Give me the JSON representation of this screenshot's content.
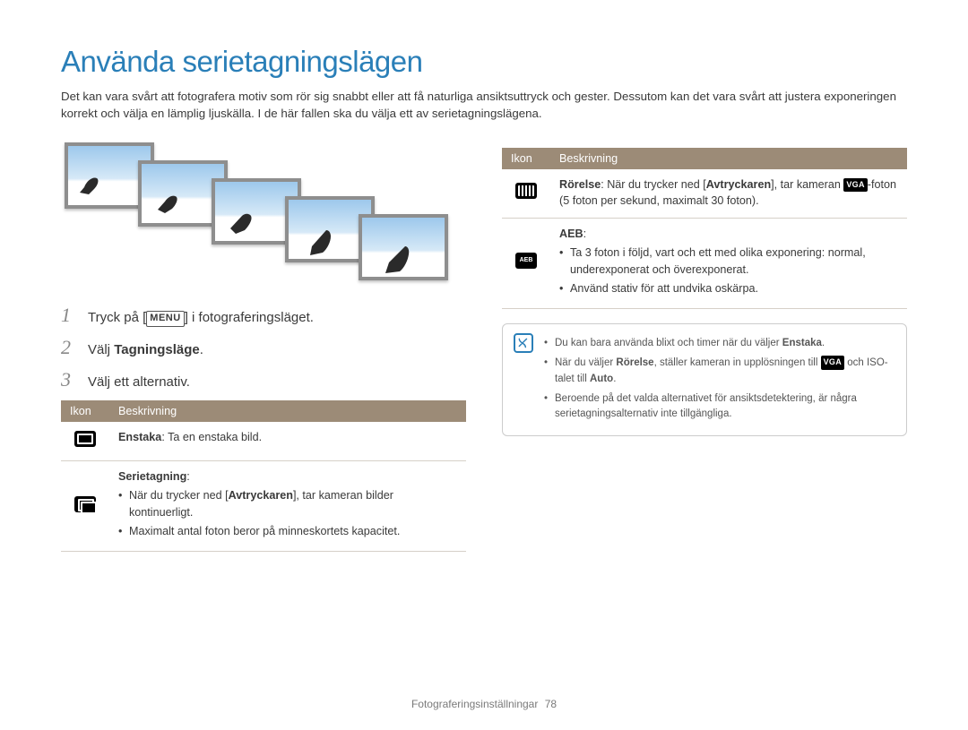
{
  "title": "Använda serietagningslägen",
  "intro": "Det kan vara svårt att fotografera motiv som rör sig snabbt eller att få naturliga ansiktsuttryck och gester. Dessutom kan det vara svårt att justera exponeringen korrekt och välja en lämplig ljuskälla. I de här fallen ska du välja ett av serietagningslägena.",
  "steps": {
    "s1_a": "Tryck på [",
    "s1_menu": "MENU",
    "s1_b": "] i fotograferingsläget.",
    "s2_a": "Välj ",
    "s2_b": "Tagningsläge",
    "s2_c": ".",
    "s3": "Välj ett alternativ."
  },
  "table_headers": {
    "icon": "Ikon",
    "desc": "Beskrivning"
  },
  "left_rows": {
    "single_label": "Enstaka",
    "single_text": ": Ta en enstaka bild.",
    "burst_label": "Serietagning",
    "burst_colon": ":",
    "burst_b1_a": "När du trycker ned [",
    "burst_b1_b": "Avtryckaren",
    "burst_b1_c": "], tar kameran bilder kontinuerligt.",
    "burst_b2": "Maximalt antal foton beror på minneskortets kapacitet."
  },
  "right_rows": {
    "motion_label": "Rörelse",
    "motion_a": ": När du trycker ned [",
    "motion_b": "Avtryckaren",
    "motion_c": "], tar kameran ",
    "motion_vga": "VGA",
    "motion_d": "-foton (5 foton per sekund, maximalt 30 foton).",
    "aeb_label": "AEB",
    "aeb_colon": ":",
    "aeb_b1": "Ta 3 foton i följd, vart och ett med olika exponering: normal, underexponerat och överexponerat.",
    "aeb_b2": "Använd stativ för att undvika oskärpa."
  },
  "note": {
    "n1_a": "Du kan bara använda blixt och timer när du väljer ",
    "n1_b": "Enstaka",
    "n1_c": ".",
    "n2_a": "När du väljer ",
    "n2_b": "Rörelse",
    "n2_c": ", ställer kameran in upplösningen till ",
    "n2_vga": "VGA",
    "n2_d": " och ISO-talet till ",
    "n2_e": "Auto",
    "n2_f": ".",
    "n3": "Beroende på det valda alternativet för ansiktsdetektering, är några serietagningsalternativ inte tillgängliga."
  },
  "footer": {
    "section": "Fotograferingsinställningar",
    "page": "78"
  }
}
